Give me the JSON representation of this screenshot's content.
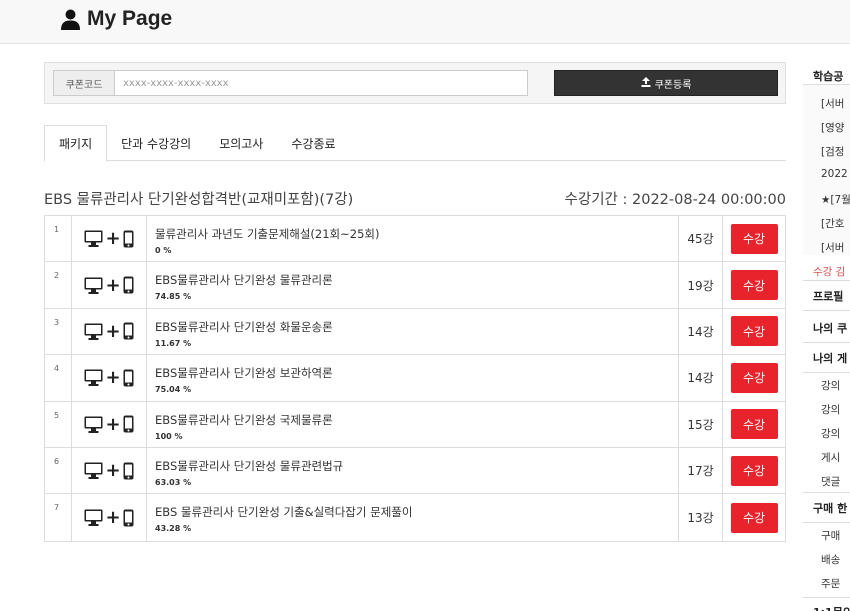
{
  "header": {
    "title": "My Page",
    "icon": "user-icon"
  },
  "coupon": {
    "label": "쿠폰코드",
    "placeholder": "xxxx-xxxx-xxxx-xxxx",
    "button_label": "쿠폰등록",
    "button_icon": "upload-icon"
  },
  "tabs": [
    {
      "label": "패키지",
      "active": true
    },
    {
      "label": "단과 수강강의",
      "active": false
    },
    {
      "label": "모의고사",
      "active": false
    },
    {
      "label": "수강종료",
      "active": false
    }
  ],
  "course": {
    "title": "EBS 물류관리사 단기완성합격반(교재미포함)(7강)",
    "period": "수강기간 : 2022-08-24 00:00:00"
  },
  "lectures": [
    {
      "num": "1",
      "name": "물류관리사 과년도 기출문제해설(21회~25회)",
      "progress": "0 %",
      "count": "45강",
      "button": "수강"
    },
    {
      "num": "2",
      "name": "EBS물류관리사 단기완성 물류관리론",
      "progress": "74.85 %",
      "count": "19강",
      "button": "수강"
    },
    {
      "num": "3",
      "name": "EBS물류관리사 단기완성 화물운송론",
      "progress": "11.67 %",
      "count": "14강",
      "button": "수강"
    },
    {
      "num": "4",
      "name": "EBS물류관리사 단기완성 보관하역론",
      "progress": "75.04 %",
      "count": "14강",
      "button": "수강"
    },
    {
      "num": "5",
      "name": "EBS물류관리사 단기완성 국제물류론",
      "progress": "100 %",
      "count": "15강",
      "button": "수강"
    },
    {
      "num": "6",
      "name": "EBS물류관리사 단기완성 물류관련법규",
      "progress": "63.03 %",
      "count": "17강",
      "button": "수강"
    },
    {
      "num": "7",
      "name": "EBS 물류관리사 단기완성 기출&실력다잡기 문제풀이",
      "progress": "43.28 %",
      "count": "13강",
      "button": "수강"
    }
  ],
  "sidebar": {
    "items": [
      {
        "label": "학습공",
        "kind": "head"
      },
      {
        "label": "[서버",
        "kind": "sub"
      },
      {
        "label": "[영양",
        "kind": "sub"
      },
      {
        "label": "[검정",
        "kind": "sub"
      },
      {
        "label": "2022",
        "kind": "sub"
      },
      {
        "label": "★[7월",
        "kind": "sub"
      },
      {
        "label": "[간호",
        "kind": "sub"
      },
      {
        "label": "[서버",
        "kind": "sub"
      },
      {
        "label": "수강 김",
        "kind": "red"
      },
      {
        "label": "프로필",
        "kind": "head"
      },
      {
        "label": "나의 쿠",
        "kind": "head"
      },
      {
        "label": "나의 게",
        "kind": "head"
      },
      {
        "label": "강의",
        "kind": "sub"
      },
      {
        "label": "강의",
        "kind": "sub"
      },
      {
        "label": "강의",
        "kind": "sub"
      },
      {
        "label": "게시",
        "kind": "sub"
      },
      {
        "label": "댓글",
        "kind": "sub"
      },
      {
        "label": "구매 한",
        "kind": "head"
      },
      {
        "label": "구매",
        "kind": "sub"
      },
      {
        "label": "배송",
        "kind": "sub"
      },
      {
        "label": "주문",
        "kind": "sub"
      },
      {
        "label": "1:1문의",
        "kind": "head"
      }
    ]
  },
  "colors": {
    "accent_red": "#e8232b",
    "dark_button": "#333333"
  }
}
